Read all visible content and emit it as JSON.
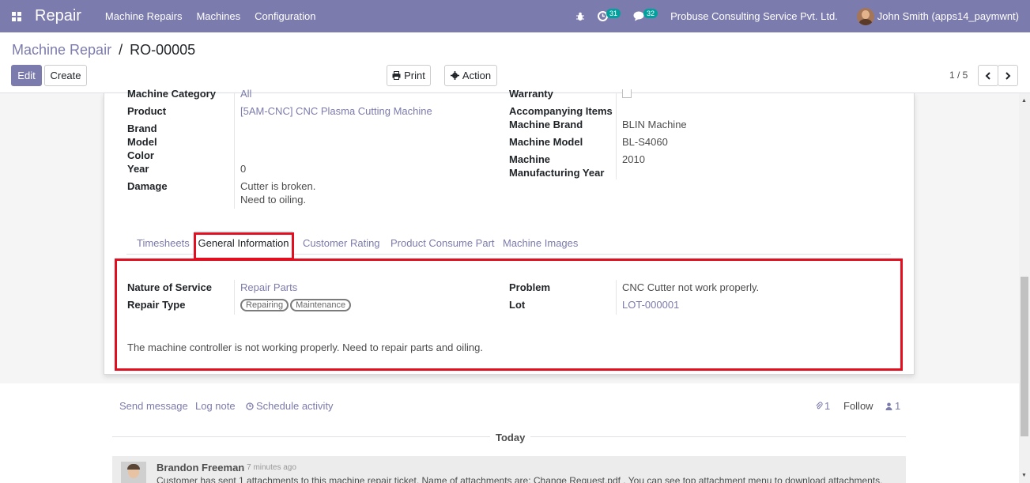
{
  "navbar": {
    "app_name": "Repair",
    "menus": [
      "Machine Repairs",
      "Machines",
      "Configuration"
    ],
    "activity_count": "31",
    "message_count": "32",
    "company": "Probuse Consulting Service Pvt. Ltd.",
    "user": "John Smith (apps14_paymwnt)",
    "accent_color": "#7c7bad"
  },
  "breadcrumb": {
    "parent": "Machine Repair",
    "separator": "/",
    "current": "RO-00005"
  },
  "buttons": {
    "edit": "Edit",
    "create": "Create",
    "print": "Print",
    "action": "Action"
  },
  "pager": {
    "value": "1 / 5"
  },
  "form": {
    "left": {
      "machine_category_label": "Machine Category",
      "machine_category_value": "All",
      "product_label": "Product",
      "product_value": "[5AM-CNC] CNC Plasma Cutting Machine",
      "brand_label": "Brand",
      "model_label": "Model",
      "color_label": "Color",
      "year_label": "Year",
      "year_value": "0",
      "damage_label": "Damage",
      "damage_line1": "Cutter is broken.",
      "damage_line2": "Need to oiling."
    },
    "right": {
      "warranty_label": "Warranty",
      "accompanying_label": "Accompanying Items",
      "machine_brand_label": "Machine Brand",
      "machine_brand_value": "BLIN Machine",
      "machine_model_label": "Machine Model",
      "machine_model_value": "BL-S4060",
      "mfg_year_label_1": "Machine",
      "mfg_year_label_2": "Manufacturing Year",
      "mfg_year_value": "2010"
    }
  },
  "tabs": [
    "Timesheets",
    "General Information",
    "Customer Rating",
    "Product Consume Part",
    "Machine Images"
  ],
  "general_info": {
    "nature_label": "Nature of Service",
    "nature_value": "Repair Parts",
    "repair_type_label": "Repair Type",
    "repair_tags": [
      "Repairing",
      "Maintenance"
    ],
    "problem_label": "Problem",
    "problem_value": "CNC Cutter not work properly.",
    "lot_label": "Lot",
    "lot_value": "LOT-000001",
    "note": "The machine controller is not working properly. Need to repair parts and oiling."
  },
  "chatter": {
    "send_message": "Send message",
    "log_note": "Log note",
    "schedule_activity": "Schedule activity",
    "attachments_count": "1",
    "follow": "Follow",
    "followers_count": "1",
    "today": "Today",
    "message": {
      "author": "Brandon Freeman",
      "date": "- 7 minutes ago",
      "body": "Customer has sent 1 attachments to this machine repair ticket. Name of attachments are: Change Request.pdf . You can see top attachment menu to download attachments."
    }
  }
}
